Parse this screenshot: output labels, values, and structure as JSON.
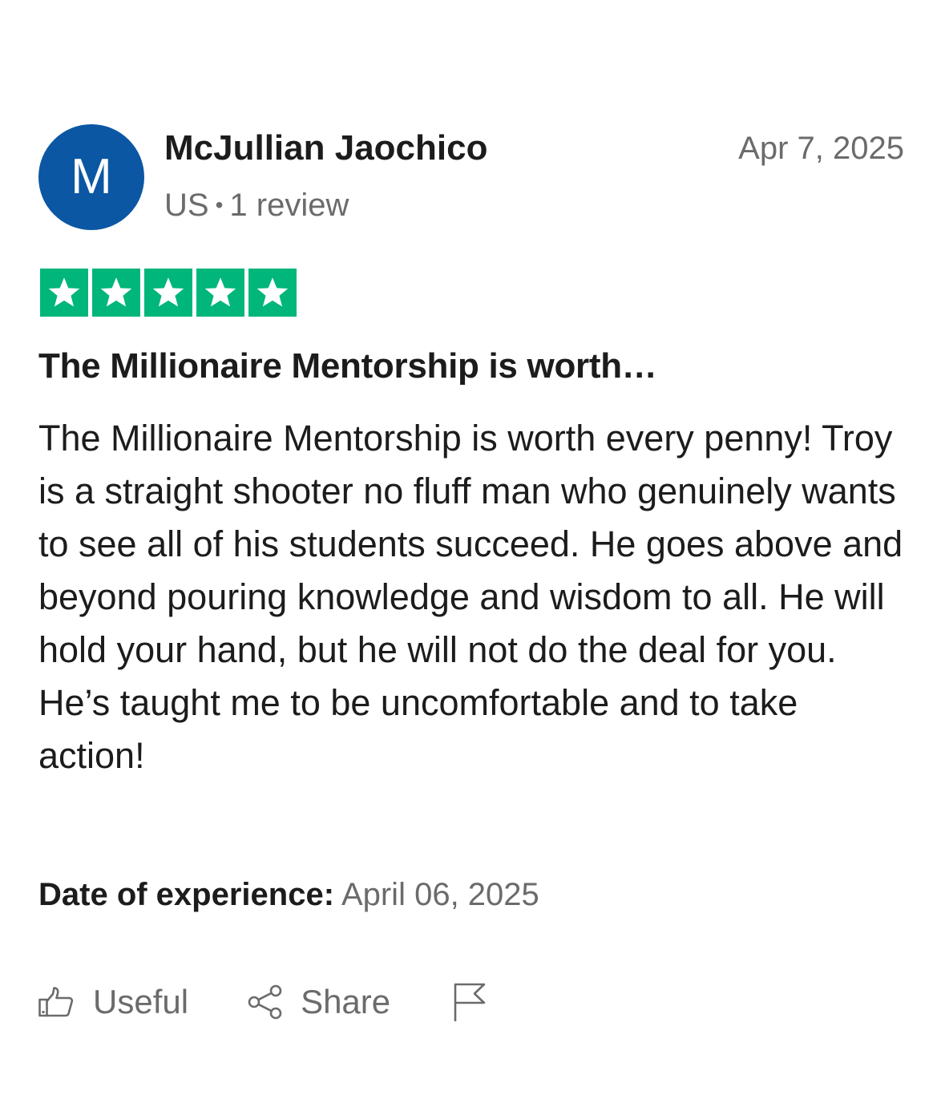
{
  "reviewer": {
    "avatar_initial": "M",
    "name": "McJullian Jaochico",
    "country": "US",
    "separator": "•",
    "review_count": "1 review"
  },
  "review": {
    "date": "Apr 7, 2025",
    "rating": 5,
    "rating_max": 5,
    "title": "The Millionaire Mentorship is worth…",
    "body": "The Millionaire Mentorship is worth every penny! Troy is a straight shooter no fluff man who genuinely wants to see all of his students succeed. He goes above and beyond pouring knowledge and wisdom to all. He will hold your hand, but he will not do the deal for you. He’s taught me to be uncomfortable and to take action!",
    "experience_label": "Date of experience:",
    "experience_date": "April 06, 2025"
  },
  "actions": {
    "useful_label": "Useful",
    "useful_icon": "thumbs-up-icon",
    "share_label": "Share",
    "share_icon": "share-icon",
    "report_icon": "flag-icon"
  },
  "colors": {
    "avatar_bg": "#0b57a4",
    "star_green": "#00b67a",
    "muted_text": "#6b6b6b",
    "primary_text": "#1c1c1c"
  }
}
